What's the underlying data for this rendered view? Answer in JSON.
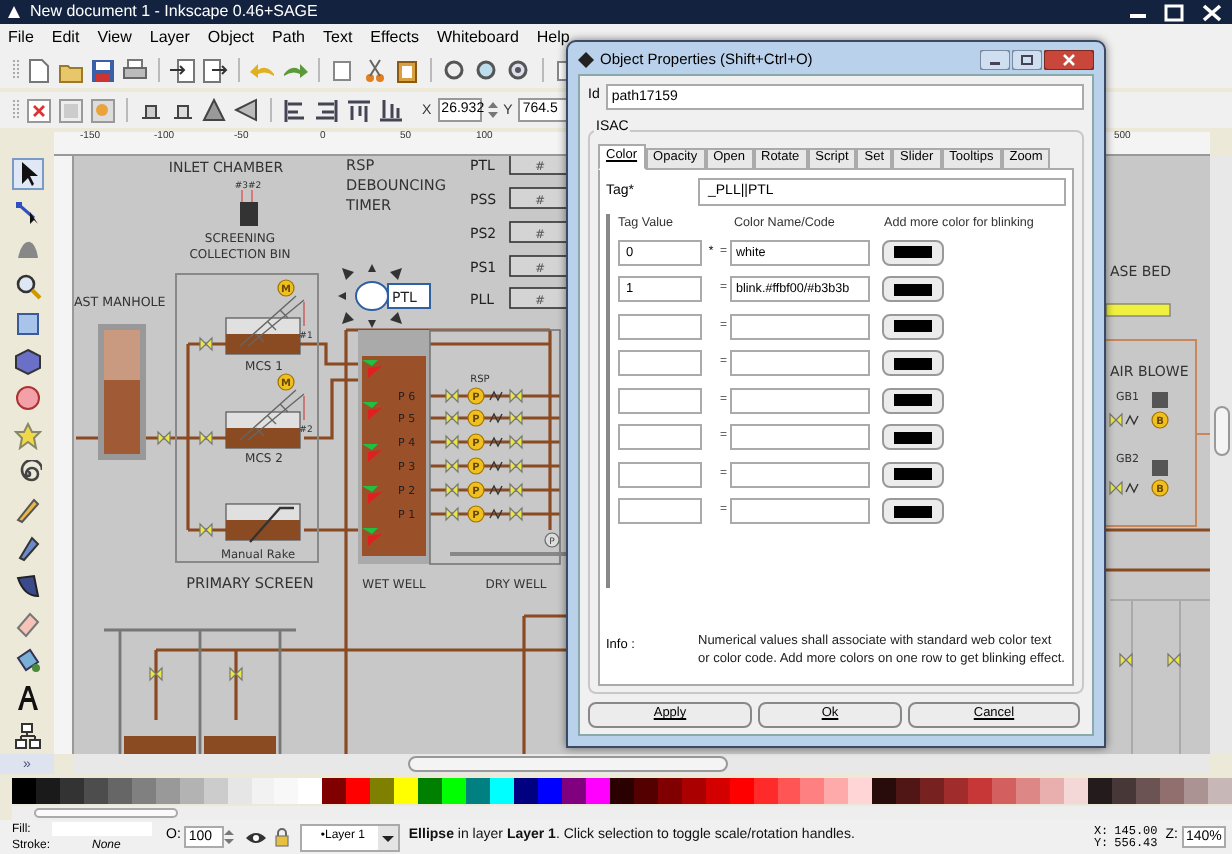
{
  "window": {
    "title": "New document 1 - Inkscape 0.46+SAGE"
  },
  "menu": [
    "File",
    "Edit",
    "View",
    "Layer",
    "Object",
    "Path",
    "Text",
    "Effects",
    "Whiteboard",
    "Help"
  ],
  "coords": {
    "x_label": "X",
    "x_value": "26.932",
    "y_label": "Y",
    "y_value": "764.5"
  },
  "ruler": [
    "-150",
    "-100",
    "-50",
    "0",
    "50",
    "100",
    "500"
  ],
  "canvas": {
    "labels": [
      "INLET CHAMBER",
      "#3#2",
      "SCREENING",
      "COLLECTION BIN",
      "AST MANHOLE",
      "MCS 1",
      "#1",
      "MCS 2",
      "#2",
      "Manual Rake",
      "PRIMARY SCREEN",
      "RSP",
      "DEBOUNCING",
      "TIMER",
      "WET WELL",
      "RSP",
      "DRY WELL",
      "ASE BED",
      "AIR BLOWE",
      "GB1",
      "GB2"
    ],
    "timers": [
      {
        "label": "PTL",
        "value": "#"
      },
      {
        "label": "PSS",
        "value": "#"
      },
      {
        "label": "PS2",
        "value": "#"
      },
      {
        "label": "PS1",
        "value": "#"
      },
      {
        "label": "PLL",
        "value": "#"
      }
    ],
    "motors": [
      "M",
      "M"
    ],
    "pumps": [
      {
        "name": "P 6",
        "symbol": "P"
      },
      {
        "name": "P 5",
        "symbol": "P"
      },
      {
        "name": "P 4",
        "symbol": "P"
      },
      {
        "name": "P 3",
        "symbol": "P"
      },
      {
        "name": "P 2",
        "symbol": "P"
      },
      {
        "name": "P 1",
        "symbol": "P"
      }
    ],
    "spare_pump": "P",
    "blowers": [
      "B",
      "B"
    ],
    "selected_tag": "PTL"
  },
  "scroll_button": "»",
  "dialog": {
    "title": "Object Properties (Shift+Ctrl+O)",
    "id_label": "Id",
    "id_value": "path17159",
    "group": "ISAC",
    "tabs": [
      {
        "label": "Color",
        "selected": true
      },
      {
        "label": "Opacity",
        "selected": false
      },
      {
        "label": "Open",
        "selected": false
      },
      {
        "label": "Rotate",
        "selected": false
      },
      {
        "label": "Script",
        "selected": false
      },
      {
        "label": "Set",
        "selected": false
      },
      {
        "label": "Slider",
        "selected": false
      },
      {
        "label": "Tooltips",
        "selected": false
      },
      {
        "label": "Zoom",
        "selected": false
      }
    ],
    "tag_label": "Tag*",
    "tag_value": "_PLL||PTL",
    "columns": [
      "Tag Value",
      "Color Name/Code",
      "Add more color for blinking"
    ],
    "rows": [
      {
        "value": "0",
        "marker": "*",
        "sign": "=",
        "color_name": "white",
        "color": "#000000"
      },
      {
        "value": "1",
        "sign": "=",
        "color_name": "blink.#ffbf00/#b3b3b",
        "color": "#000000"
      },
      {
        "value": "",
        "sign": "=",
        "color_name": "",
        "color": "#000000"
      },
      {
        "value": "",
        "sign": "=",
        "color_name": "",
        "color": "#000000"
      },
      {
        "value": "",
        "sign": "=",
        "color_name": "",
        "color": "#000000"
      },
      {
        "value": "",
        "sign": "=",
        "color_name": "",
        "color": "#000000"
      },
      {
        "value": "",
        "sign": "=",
        "color_name": "",
        "color": "#000000"
      },
      {
        "value": "",
        "sign": "=",
        "color_name": "",
        "color": "#000000"
      }
    ],
    "info_label": "Info :",
    "info_text": "Numerical values shall associate with standard web color text or color code. Add more colors on one row to get blinking effect.",
    "buttons": [
      "Apply",
      "Ok",
      "Cancel"
    ]
  },
  "palette": [
    {
      "color": "#000000"
    },
    {
      "color": "#1a1a1a"
    },
    {
      "color": "#333333"
    },
    {
      "color": "#4d4d4d"
    },
    {
      "color": "#666666"
    },
    {
      "color": "#808080"
    },
    {
      "color": "#999999"
    },
    {
      "color": "#b3b3b3"
    },
    {
      "color": "#cccccc"
    },
    {
      "color": "#e6e6e6"
    },
    {
      "color": "#f2f2f2"
    },
    {
      "color": "#f8f8f8"
    },
    {
      "color": "#ffffff"
    },
    {
      "color": "#800000"
    },
    {
      "color": "#ff0000"
    },
    {
      "color": "#808000"
    },
    {
      "color": "#ffff00"
    },
    {
      "color": "#008000"
    },
    {
      "color": "#00ff00"
    },
    {
      "color": "#008080"
    },
    {
      "color": "#00ffff"
    },
    {
      "color": "#000080"
    },
    {
      "color": "#0000ff"
    },
    {
      "color": "#800080"
    },
    {
      "color": "#ff00ff"
    },
    {
      "color": "#2b0000"
    },
    {
      "color": "#550000"
    },
    {
      "color": "#800001"
    },
    {
      "color": "#aa0000"
    },
    {
      "color": "#d40000"
    },
    {
      "color": "#ff0001"
    },
    {
      "color": "#ff2a2a"
    },
    {
      "color": "#ff5555"
    },
    {
      "color": "#ff8080"
    },
    {
      "color": "#ffaaaa"
    },
    {
      "color": "#ffd5d5"
    },
    {
      "color": "#280b0b"
    },
    {
      "color": "#501616"
    },
    {
      "color": "#782121"
    },
    {
      "color": "#a02c2c"
    },
    {
      "color": "#c83737"
    },
    {
      "color": "#d35f5f"
    },
    {
      "color": "#de8787"
    },
    {
      "color": "#e9afaf"
    },
    {
      "color": "#f4d7d7"
    },
    {
      "color": "#241c1c"
    },
    {
      "color": "#483737"
    },
    {
      "color": "#6c5353"
    },
    {
      "color": "#916f6f"
    },
    {
      "color": "#ac9393"
    },
    {
      "color": "#c8b7b7"
    }
  ],
  "status": {
    "fill_label": "Fill:",
    "stroke_label": "Stroke:",
    "stroke_value": "None",
    "opacity_label": "O:",
    "opacity": "100",
    "layer": "•Layer 1",
    "message": "**Ellipse** in layer **Layer 1**. Click selection to toggle scale/rotation handles.",
    "x_label": "X:",
    "x_value": "145.00",
    "y_label": "Y:",
    "y_value": "556.43",
    "zoom_label": "Z:",
    "zoom": "140%"
  }
}
